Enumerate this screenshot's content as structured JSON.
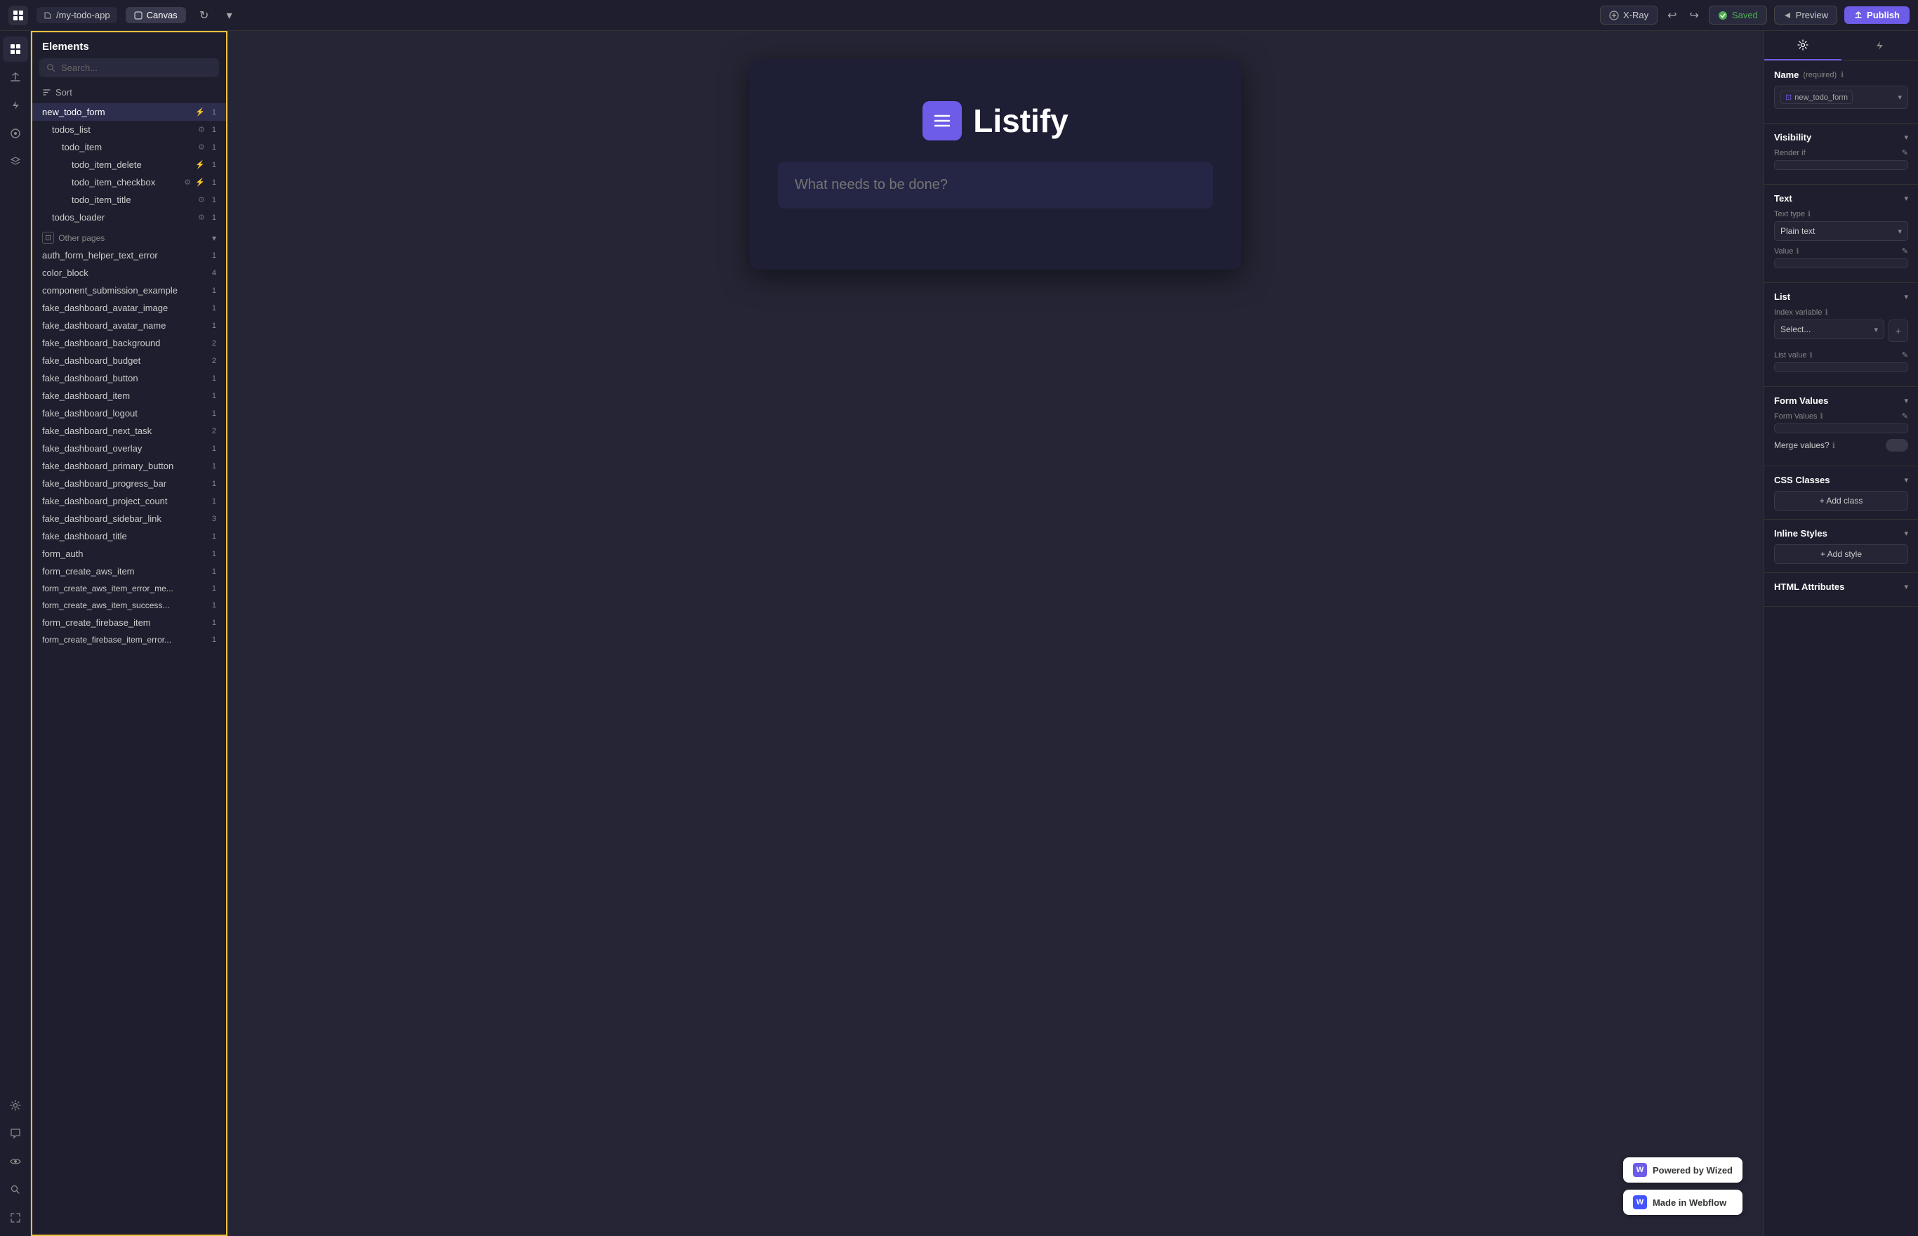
{
  "topbar": {
    "logo_icon": "grid",
    "file_label": "/my-todo-app",
    "canvas_tab": "Canvas",
    "refresh_icon": "refresh",
    "chevron_icon": "chevron-down",
    "xray_label": "X-Ray",
    "undo_icon": "undo",
    "redo_icon": "redo",
    "saved_label": "Saved",
    "preview_label": "Preview",
    "publish_label": "Publish"
  },
  "elements_panel": {
    "title": "Elements",
    "search_placeholder": "Search...",
    "sort_label": "Sort",
    "items": [
      {
        "name": "new_todo_form",
        "indent": 0,
        "selected": true,
        "bolt": true,
        "count": 1
      },
      {
        "name": "todos_list",
        "indent": 1,
        "gear": true,
        "count": 1
      },
      {
        "name": "todo_item",
        "indent": 2,
        "gear": true,
        "count": 1
      },
      {
        "name": "todo_item_delete",
        "indent": 3,
        "bolt": true,
        "count": 1
      },
      {
        "name": "todo_item_checkbox",
        "indent": 3,
        "gear": true,
        "bolt": true,
        "count": 1
      },
      {
        "name": "todo_item_title",
        "indent": 3,
        "gear": true,
        "count": 1
      },
      {
        "name": "todos_loader",
        "indent": 1,
        "gear": true,
        "count": 1
      }
    ],
    "other_pages_label": "Other pages",
    "other_items": [
      {
        "name": "auth_form_helper_text_error",
        "count": 1
      },
      {
        "name": "color_block",
        "count": 4
      },
      {
        "name": "component_submission_example",
        "count": 1
      },
      {
        "name": "fake_dashboard_avatar_image",
        "count": 1
      },
      {
        "name": "fake_dashboard_avatar_name",
        "count": 1
      },
      {
        "name": "fake_dashboard_background",
        "count": 2
      },
      {
        "name": "fake_dashboard_budget",
        "count": 2
      },
      {
        "name": "fake_dashboard_button",
        "count": 1
      },
      {
        "name": "fake_dashboard_item",
        "count": 1
      },
      {
        "name": "fake_dashboard_logout",
        "count": 1
      },
      {
        "name": "fake_dashboard_next_task",
        "count": 2
      },
      {
        "name": "fake_dashboard_overlay",
        "count": 1
      },
      {
        "name": "fake_dashboard_primary_button",
        "count": 1
      },
      {
        "name": "fake_dashboard_progress_bar",
        "count": 1
      },
      {
        "name": "fake_dashboard_project_count",
        "count": 1
      },
      {
        "name": "fake_dashboard_sidebar_link",
        "count": 3
      },
      {
        "name": "fake_dashboard_title",
        "count": 1
      },
      {
        "name": "form_auth",
        "count": 1
      },
      {
        "name": "form_create_aws_item",
        "count": 1
      },
      {
        "name": "form_create_aws_item_error_me...",
        "count": 1
      },
      {
        "name": "form_create_aws_item_success...",
        "count": 1
      },
      {
        "name": "form_create_firebase_item",
        "count": 1
      },
      {
        "name": "form_create_firebase_item_error...",
        "count": 1
      }
    ]
  },
  "canvas": {
    "app_icon": "≡",
    "app_name": "Listify",
    "input_placeholder": "What needs to be done?",
    "wized_label": "Powered by Wized",
    "webflow_label": "Made in Webflow"
  },
  "right_panel": {
    "settings_tab": "⚙",
    "bolt_tab": "⚡",
    "name_section": "Name",
    "name_required": "(required)",
    "name_value": "new_todo_form",
    "visibility_section": "Visibility",
    "render_if_label": "Render if",
    "text_section": "Text",
    "text_type_label": "Text type",
    "text_type_info": "ℹ",
    "text_type_value": "Plain text",
    "value_label": "Value",
    "list_section": "List",
    "index_variable_label": "Index variable",
    "index_variable_info": "ℹ",
    "index_select_placeholder": "Select...",
    "list_value_label": "List value",
    "list_value_info": "ℹ",
    "form_values_section": "Form Values",
    "form_values_label": "Form Values",
    "form_values_info": "ℹ",
    "merge_values_label": "Merge values?",
    "merge_values_info": "ℹ",
    "css_classes_section": "CSS Classes",
    "add_class_label": "+ Add class",
    "inline_styles_section": "Inline Styles",
    "add_style_label": "+ Add style",
    "html_attributes_section": "HTML Attributes"
  },
  "icons": {
    "grid": "⊞",
    "layers": "≡",
    "lightning": "⚡",
    "components": "◎",
    "menu": "☰",
    "settings": "⚙",
    "search": "🔍",
    "user": "👤",
    "eye": "👁",
    "bookmark": "🔖",
    "move": "⊕",
    "magnify": "🔍"
  }
}
